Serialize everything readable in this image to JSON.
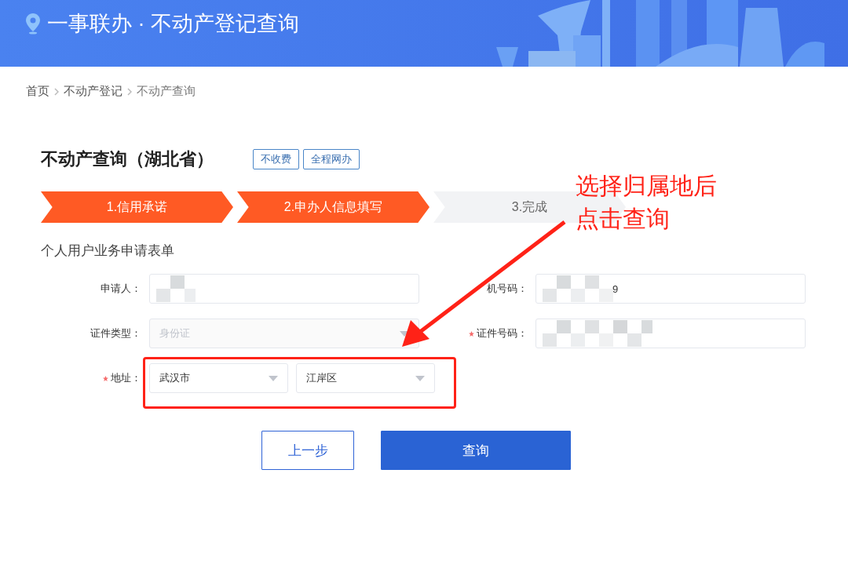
{
  "header": {
    "title": "一事联办 · 不动产登记查询"
  },
  "breadcrumb": [
    {
      "label": "首页"
    },
    {
      "label": "不动产登记"
    },
    {
      "label": "不动产查询"
    }
  ],
  "page": {
    "title": "不动产查询（湖北省）",
    "tags": [
      "不收费",
      "全程网办"
    ]
  },
  "steps": [
    {
      "label": "1.信用承诺",
      "done": true
    },
    {
      "label": "2.申办人信息填写",
      "done": true
    },
    {
      "label": "3.完成",
      "done": false
    }
  ],
  "form": {
    "title": "个人用户业务申请表单",
    "fields": [
      {
        "label": "申请人：",
        "kind": "input",
        "required": false,
        "redacted": true
      },
      {
        "label": "机号码：",
        "kind": "input",
        "required": false,
        "redacted": true,
        "value": "9"
      },
      {
        "label": "证件类型：",
        "kind": "select",
        "required": false,
        "disabled": true,
        "value": "身份证"
      },
      {
        "label": "证件号码：",
        "kind": "input",
        "required": true,
        "redacted": true
      },
      {
        "label": "地址：",
        "kind": "selects",
        "required": true,
        "highlighted": true,
        "values": [
          "武汉市",
          "江岸区"
        ]
      }
    ]
  },
  "buttons": [
    {
      "label": "上一步",
      "kind": "secondary"
    },
    {
      "label": "查询",
      "kind": "primary"
    }
  ],
  "annotation": {
    "text": [
      "选择归属地后",
      "点击查询"
    ]
  }
}
